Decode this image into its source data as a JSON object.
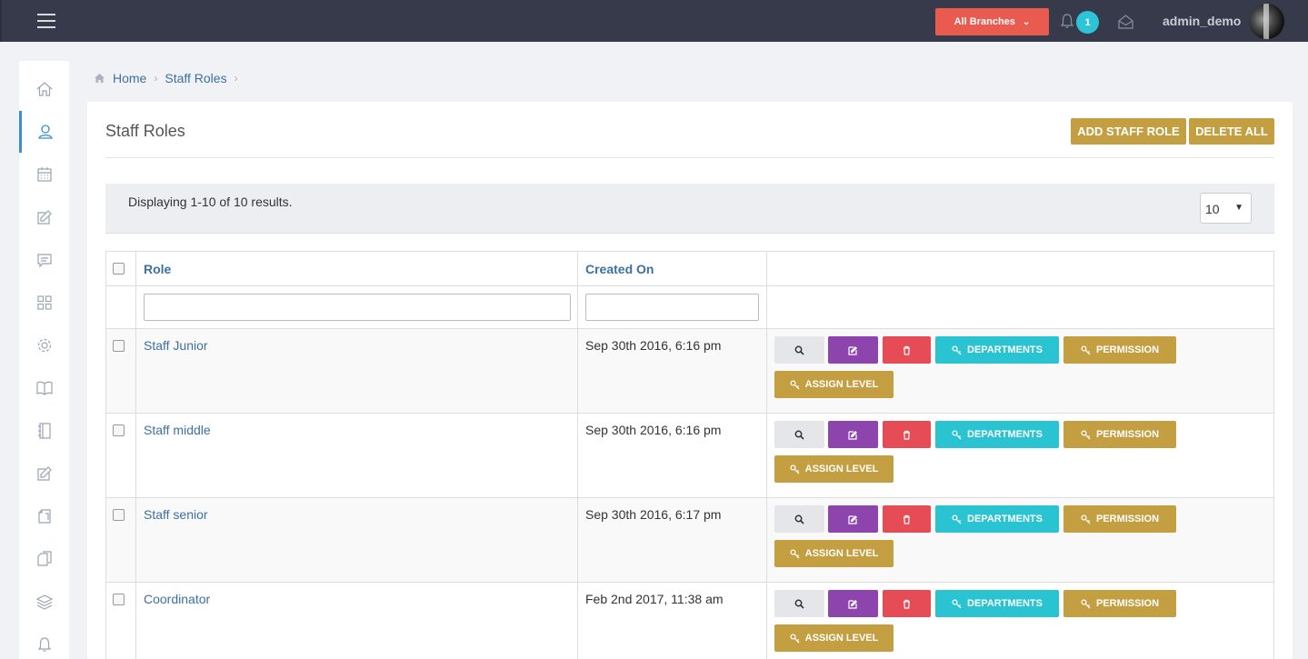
{
  "topbar": {
    "branch_label": "All Branches",
    "notification_count": "1",
    "username": "admin_demo"
  },
  "sidebar": {
    "icons": [
      "home-icon",
      "staff-icon",
      "calendar-icon",
      "edit-icon",
      "chat-icon",
      "grid-icon",
      "settings-icon",
      "book-icon",
      "notebook-icon",
      "edit-note-icon",
      "document-icon",
      "documents-icon",
      "layers-icon",
      "bell-icon"
    ],
    "active_index": 1
  },
  "breadcrumb": {
    "home": "Home",
    "current": "Staff Roles"
  },
  "panel": {
    "title": "Staff Roles",
    "add_label": "ADD STAFF ROLE",
    "delete_all_label": "DELETE ALL"
  },
  "summary": {
    "text": "Displaying 1-10 of 10 results.",
    "page_size": "10"
  },
  "table": {
    "headers": {
      "role": "Role",
      "created_on": "Created On"
    },
    "actions": {
      "departments": "DEPARTMENTS",
      "permission": "PERMISSION",
      "assign_level": "ASSIGN LEVEL"
    },
    "rows": [
      {
        "role": "Staff Junior",
        "created_on": "Sep 30th 2016, 6:16 pm"
      },
      {
        "role": "Staff middle",
        "created_on": "Sep 30th 2016, 6:16 pm"
      },
      {
        "role": "Staff senior",
        "created_on": "Sep 30th 2016, 6:17 pm"
      },
      {
        "role": "Coordinator",
        "created_on": "Feb 2nd 2017, 11:38 am"
      }
    ]
  },
  "colors": {
    "topbar": "#363a4b",
    "branch_button": "#ea5b4f",
    "badge": "#2cc4d6",
    "gold": "#c49f42",
    "purple": "#8e44ad",
    "red": "#e64c55",
    "teal": "#2ac3d2",
    "link": "#3c6fa3"
  }
}
